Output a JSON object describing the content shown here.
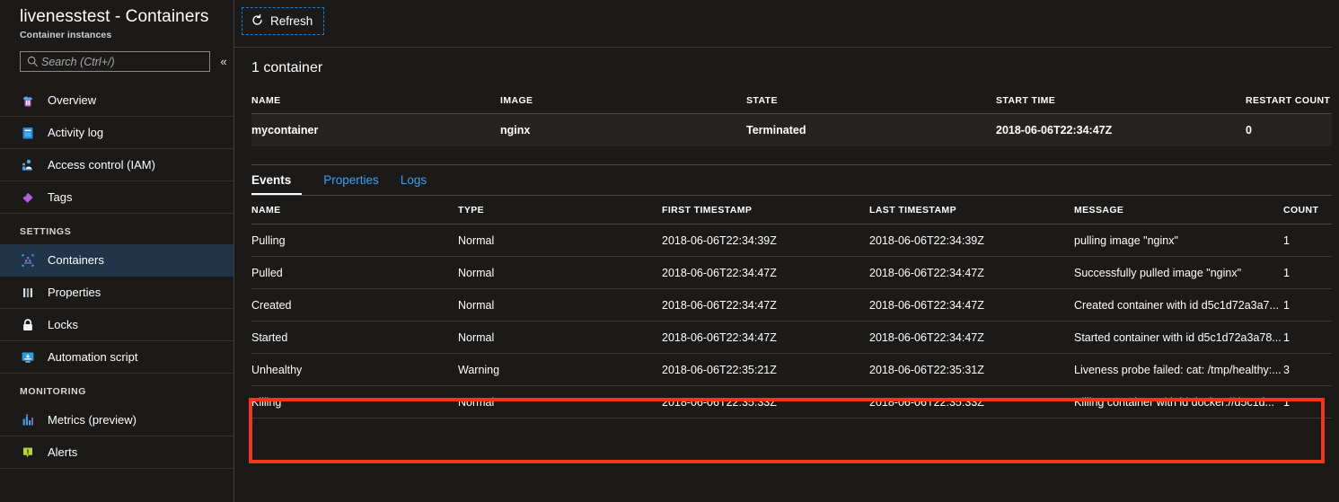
{
  "blade": {
    "title": "livenesstest - Containers",
    "subtitle": "Container instances"
  },
  "search": {
    "placeholder": "Search (Ctrl+/)",
    "value": "",
    "icon": "search-icon"
  },
  "collapse": {
    "glyph": "«",
    "label": "collapse-blade"
  },
  "sidebar": {
    "items": [
      {
        "label": "Overview",
        "icon": "overview-cloud-icon"
      },
      {
        "label": "Activity log",
        "icon": "activity-log-book-icon"
      },
      {
        "label": "Access control (IAM)",
        "icon": "access-control-people-icon"
      },
      {
        "label": "Tags",
        "icon": "tag-icon"
      }
    ],
    "settings_header": "SETTINGS",
    "settings_items": [
      {
        "label": "Containers",
        "icon": "containers-icon",
        "selected": true
      },
      {
        "label": "Properties",
        "icon": "properties-sliders-icon",
        "selected": false
      },
      {
        "label": "Locks",
        "icon": "lock-icon",
        "selected": false
      },
      {
        "label": "Automation script",
        "icon": "automation-script-monitor-icon",
        "selected": false
      }
    ],
    "monitoring_header": "MONITORING",
    "monitoring_items": [
      {
        "label": "Metrics (preview)",
        "icon": "metrics-bar-chart-icon"
      },
      {
        "label": "Alerts",
        "icon": "alerts-bell-badge-icon"
      }
    ]
  },
  "toolbar": {
    "refresh_label": "Refresh",
    "refresh_icon": "refresh-circular-arrow-icon"
  },
  "containers": {
    "count_title": "1 container",
    "columns": [
      "NAME",
      "IMAGE",
      "STATE",
      "START TIME",
      "RESTART COUNT"
    ],
    "rows": [
      {
        "name": "mycontainer",
        "image": "nginx",
        "state": "Terminated",
        "start_time": "2018-06-06T22:34:47Z",
        "restart_count": "0"
      }
    ]
  },
  "tabs": [
    {
      "label": "Events",
      "active": true
    },
    {
      "label": "Properties",
      "active": false
    },
    {
      "label": "Logs",
      "active": false
    }
  ],
  "events": {
    "columns": [
      "NAME",
      "TYPE",
      "FIRST TIMESTAMP",
      "LAST TIMESTAMP",
      "MESSAGE",
      "COUNT"
    ],
    "rows": [
      {
        "name": "Pulling",
        "type": "Normal",
        "first_timestamp": "2018-06-06T22:34:39Z",
        "last_timestamp": "2018-06-06T22:34:39Z",
        "message": "pulling image \"nginx\"",
        "count": "1",
        "highlighted": false
      },
      {
        "name": "Pulled",
        "type": "Normal",
        "first_timestamp": "2018-06-06T22:34:47Z",
        "last_timestamp": "2018-06-06T22:34:47Z",
        "message": "Successfully pulled image \"nginx\"",
        "count": "1",
        "highlighted": false
      },
      {
        "name": "Created",
        "type": "Normal",
        "first_timestamp": "2018-06-06T22:34:47Z",
        "last_timestamp": "2018-06-06T22:34:47Z",
        "message": "Created container with id d5c1d72a3a7...",
        "count": "1",
        "highlighted": false
      },
      {
        "name": "Started",
        "type": "Normal",
        "first_timestamp": "2018-06-06T22:34:47Z",
        "last_timestamp": "2018-06-06T22:34:47Z",
        "message": "Started container with id d5c1d72a3a78...",
        "count": "1",
        "highlighted": false
      },
      {
        "name": "Unhealthy",
        "type": "Warning",
        "first_timestamp": "2018-06-06T22:35:21Z",
        "last_timestamp": "2018-06-06T22:35:31Z",
        "message": "Liveness probe failed: cat: /tmp/healthy:...",
        "count": "3",
        "highlighted": true
      },
      {
        "name": "Killing",
        "type": "Normal",
        "first_timestamp": "2018-06-06T22:35:33Z",
        "last_timestamp": "2018-06-06T22:35:33Z",
        "message": "Killing container with id docker://d5c1d...",
        "count": "1",
        "highlighted": true
      }
    ]
  },
  "colors": {
    "page_background": "#1b1a19",
    "row_background": "#252423",
    "selected_nav": "#20354a",
    "link_blue": "#3aa0f3",
    "focus_blue": "#0b84d9",
    "highlight_red": "#f4341b"
  }
}
